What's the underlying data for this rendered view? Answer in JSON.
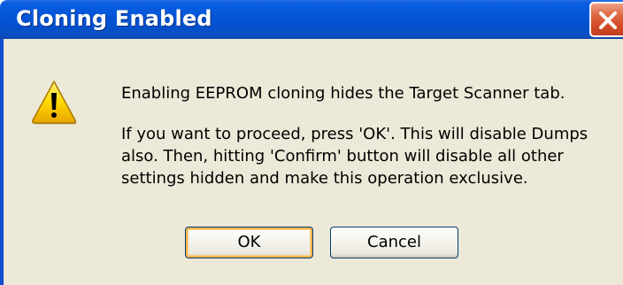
{
  "dialog": {
    "title": "Cloning Enabled",
    "close_icon": "close-icon",
    "icon": "warning-icon",
    "message_line1": "Enabling EEPROM cloning hides the Target Scanner tab.",
    "message_line2": "If you want to proceed, press 'OK'. This will disable Dumps also. Then, hitting 'Confirm' button will disable all other settings hidden and make this operation exclusive.",
    "ok_label": "OK",
    "cancel_label": "Cancel"
  },
  "colors": {
    "titlebar": "#0454d6",
    "client_bg": "#ece9d8",
    "close_button": "#d24a26",
    "focus_ring": "#f8b34c"
  }
}
